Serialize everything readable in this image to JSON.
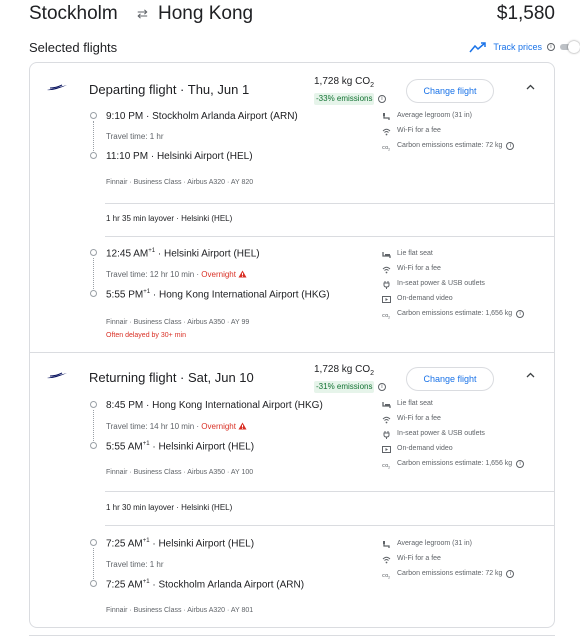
{
  "header": {
    "origin": "Stockholm",
    "destination": "Hong Kong",
    "price": "$1,580"
  },
  "selected_flights_label": "Selected flights",
  "track_prices": {
    "label": "Track prices",
    "enabled": false
  },
  "departing": {
    "title": "Departing flight · Thu, Jun 1",
    "co2": "1,728 kg CO",
    "co2_sub": "2",
    "emissions_badge": "-33% emissions",
    "change_label": "Change flight",
    "segment1": {
      "depart_time": "9:10 PM",
      "depart_airport": "Stockholm Arlanda Airport (ARN)",
      "travel_time": "Travel time: 1 hr",
      "arrive_time": "11:10 PM",
      "arrive_airport": "Helsinki Airport (HEL)",
      "meta": "Finnair · Business Class · Airbus A320 · AY 820",
      "amenities": [
        {
          "icon": "legroom-icon",
          "label": "Average legroom (31 in)"
        },
        {
          "icon": "wifi-icon",
          "label": "Wi-Fi for a fee"
        },
        {
          "icon": "co2-icon",
          "label": "Carbon emissions estimate: 72 kg"
        }
      ]
    },
    "layover": "1 hr 35 min layover · Helsinki (HEL)",
    "segment2": {
      "depart_time": "12:45 AM",
      "depart_sup": "+1",
      "depart_airport": "Helsinki Airport (HEL)",
      "travel_time": "Travel time: 12 hr 10 min",
      "overnight": "Overnight",
      "arrive_time": "5:55 PM",
      "arrive_sup": "+1",
      "arrive_airport": "Hong Kong International Airport (HKG)",
      "meta": "Finnair · Business Class · Airbus A350 · AY 99",
      "delay": "Often delayed by 30+ min",
      "amenities": [
        {
          "icon": "lie-flat-seat-icon",
          "label": "Lie flat seat"
        },
        {
          "icon": "wifi-icon",
          "label": "Wi-Fi for a fee"
        },
        {
          "icon": "power-plug-icon",
          "label": "In-seat power & USB outlets"
        },
        {
          "icon": "video-icon",
          "label": "On-demand video"
        },
        {
          "icon": "co2-icon",
          "label": "Carbon emissions estimate: 1,656 kg"
        }
      ]
    }
  },
  "returning": {
    "title": "Returning flight · Sat, Jun 10",
    "co2": "1,728 kg CO",
    "co2_sub": "2",
    "emissions_badge": "-31% emissions",
    "change_label": "Change flight",
    "segment1": {
      "depart_time": "8:45 PM",
      "depart_airport": "Hong Kong International Airport (HKG)",
      "travel_time": "Travel time: 14 hr 10 min",
      "overnight": "Overnight",
      "arrive_time": "5:55 AM",
      "arrive_sup": "+1",
      "arrive_airport": "Helsinki Airport (HEL)",
      "meta": "Finnair · Business Class · Airbus A350 · AY 100",
      "amenities": [
        {
          "icon": "lie-flat-seat-icon",
          "label": "Lie flat seat"
        },
        {
          "icon": "wifi-icon",
          "label": "Wi-Fi for a fee"
        },
        {
          "icon": "power-plug-icon",
          "label": "In-seat power & USB outlets"
        },
        {
          "icon": "video-icon",
          "label": "On-demand video"
        },
        {
          "icon": "co2-icon",
          "label": "Carbon emissions estimate: 1,656 kg"
        }
      ]
    },
    "layover": "1 hr 30 min layover · Helsinki (HEL)",
    "segment2": {
      "depart_time": "7:25 AM",
      "depart_sup": "+1",
      "depart_airport": "Helsinki Airport (HEL)",
      "travel_time": "Travel time: 1 hr",
      "arrive_time": "7:25 AM",
      "arrive_sup": "+1",
      "arrive_airport": "Stockholm Arlanda Airport (ARN)",
      "meta": "Finnair · Business Class · Airbus A320 · AY 801",
      "amenities": [
        {
          "icon": "legroom-icon",
          "label": "Average legroom (31 in)"
        },
        {
          "icon": "wifi-icon",
          "label": "Wi-Fi for a fee"
        },
        {
          "icon": "co2-icon",
          "label": "Carbon emissions estimate: 72 kg"
        }
      ]
    }
  },
  "colors": {
    "accent": "#1a73e8",
    "emissions_bg": "#e6f4ea",
    "emissions_text": "#137333",
    "warning": "#d93025",
    "finnair_logo": "#0b1560"
  }
}
